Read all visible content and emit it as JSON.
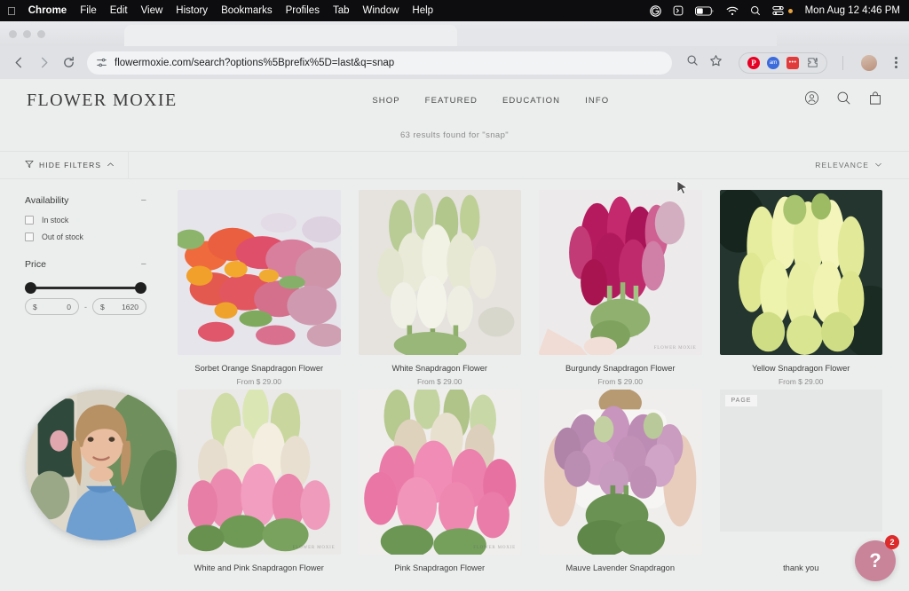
{
  "menubar": {
    "apple_icon": "apple-icon",
    "items": [
      "Chrome",
      "File",
      "Edit",
      "View",
      "History",
      "Bookmarks",
      "Profiles",
      "Tab",
      "Window",
      "Help"
    ],
    "status_icons": [
      "grammarly-icon",
      "shortcuts-icon",
      "battery-icon",
      "wifi-icon",
      "spotlight-search-icon",
      "control-center-icon"
    ],
    "clock": "Mon Aug 12  4:46 PM"
  },
  "browser": {
    "back_icon": "back-arrow-icon",
    "forward_icon": "forward-arrow-icon",
    "reload_icon": "reload-icon",
    "site_settings_icon": "site-settings-icon",
    "url": "flowermoxie.com/search?options%5Bprefix%5D=last&q=snap",
    "zoom_search_icon": "page-search-icon",
    "bookmark_icon": "bookmark-star-icon",
    "extensions": [
      {
        "name": "pinterest-extension",
        "label": "P"
      },
      {
        "name": "blue-extension",
        "label": "am"
      },
      {
        "name": "red-extension",
        "label": "•••"
      },
      {
        "name": "extensions-puzzle-icon",
        "label": ""
      }
    ],
    "profile_icon": "profile-avatar-icon",
    "menu_icon": "chrome-menu-icon"
  },
  "site": {
    "brand": "FLOWER MOXIE",
    "nav": [
      "SHOP",
      "FEATURED",
      "EDUCATION",
      "INFO"
    ],
    "header_icons": [
      "account-icon",
      "search-icon",
      "shopping-bag-icon"
    ],
    "results_text": "63 results found for \"snap\"",
    "filterbar": {
      "funnel_icon": "filter-funnel-icon",
      "hide_filters_label": "HIDE FILTERS",
      "chevron_up_icon": "chevron-up-icon",
      "sort_label": "RELEVANCE",
      "chevron_down_icon": "chevron-down-icon"
    },
    "filters": {
      "availability": {
        "title": "Availability",
        "collapse_icon": "minus-icon",
        "options": [
          {
            "label": "In stock",
            "checked": false
          },
          {
            "label": "Out of stock",
            "checked": false
          }
        ]
      },
      "price": {
        "title": "Price",
        "collapse_icon": "minus-icon",
        "currency": "$",
        "min_value": "0",
        "max_value": "1620",
        "separator": "-"
      }
    },
    "products": [
      {
        "title": "Sorbet Orange Snapdragon Flower",
        "price": "From $ 29.00",
        "image": "sorbet-orange-snapdragon",
        "watermark": ""
      },
      {
        "title": "White Snapdragon Flower",
        "price": "From $ 29.00",
        "image": "white-snapdragon",
        "watermark": ""
      },
      {
        "title": "Burgundy Snapdragon Flower",
        "price": "From $ 29.00",
        "image": "burgundy-snapdragon",
        "watermark": "FLOWER MOXIE"
      },
      {
        "title": "Yellow Snapdragon Flower",
        "price": "From $ 29.00",
        "image": "yellow-snapdragon",
        "watermark": ""
      },
      {
        "title": "White and Pink Snapdragon Flower",
        "price": "",
        "image": "white-and-pink-snapdragon",
        "watermark": "FLOWER MOXIE"
      },
      {
        "title": "Pink Snapdragon Flower",
        "price": "",
        "image": "pink-snapdragon",
        "watermark": "FLOWER MOXIE"
      },
      {
        "title": "Mauve Lavender Snapdragon",
        "price": "",
        "image": "mauve-lavender-snapdragon",
        "watermark": ""
      }
    ],
    "page_result": {
      "badge": "PAGE",
      "caption": "thank you"
    },
    "help_widget": {
      "icon_label": "?",
      "badge_count": "2",
      "color": "#c9849a",
      "badge_color": "#dd2a2a"
    },
    "video_bubble": {
      "name": "video-chat-bubble"
    }
  }
}
